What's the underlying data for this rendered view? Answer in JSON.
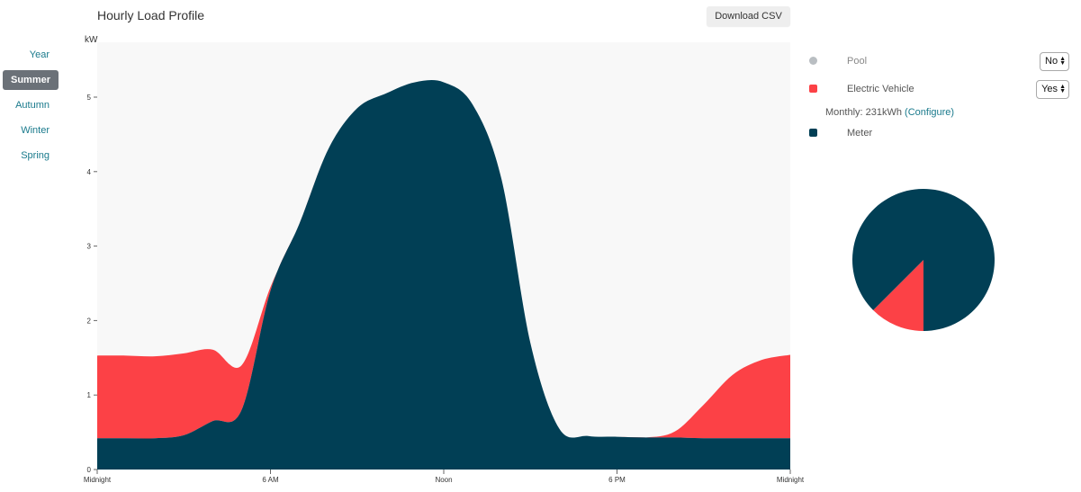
{
  "header": {
    "title": "Hourly Load Profile",
    "download_label": "Download CSV"
  },
  "seasons": [
    {
      "label": "Year",
      "active": false
    },
    {
      "label": "Summer",
      "active": true
    },
    {
      "label": "Autumn",
      "active": false
    },
    {
      "label": "Winter",
      "active": false
    },
    {
      "label": "Spring",
      "active": false
    }
  ],
  "legend": {
    "pool": {
      "label": "Pool",
      "value": "No",
      "color": "#b9bec2"
    },
    "ev": {
      "label": "Electric Vehicle",
      "value": "Yes",
      "color": "#fc4146"
    },
    "monthly_text": "Monthly: 231kWh",
    "configure_label": "(Configure)",
    "meter": {
      "label": "Meter",
      "color": "#013f55"
    }
  },
  "chart_data": [
    {
      "type": "area",
      "stacked": true,
      "title": "Hourly Load Profile",
      "ylabel": "kW",
      "xlabel": "",
      "ylim": [
        0,
        5.6
      ],
      "yticks": [
        0,
        1,
        2,
        3,
        4,
        5
      ],
      "xticks": [
        {
          "hour": 0,
          "label": "Midnight"
        },
        {
          "hour": 6,
          "label": "6 AM"
        },
        {
          "hour": 12,
          "label": "Noon"
        },
        {
          "hour": 18,
          "label": "6 PM"
        },
        {
          "hour": 24,
          "label": "Midnight"
        }
      ],
      "x": [
        0,
        1,
        2,
        3,
        4,
        5,
        6,
        7,
        8,
        9,
        10,
        11,
        12,
        13,
        14,
        15,
        16,
        17,
        18,
        19,
        20,
        21,
        22,
        23,
        24
      ],
      "series": [
        {
          "name": "Meter",
          "color": "#013f55",
          "values": [
            0.42,
            0.42,
            0.42,
            0.46,
            0.65,
            0.8,
            2.4,
            3.3,
            4.3,
            4.85,
            5.05,
            5.2,
            5.2,
            4.9,
            3.9,
            1.7,
            0.55,
            0.45,
            0.44,
            0.43,
            0.43,
            0.42,
            0.42,
            0.42,
            0.42
          ]
        },
        {
          "name": "Electric Vehicle",
          "color": "#fc4146",
          "values": [
            1.11,
            1.11,
            1.1,
            1.1,
            0.96,
            0.6,
            0.05,
            0.0,
            0.0,
            0.0,
            0.0,
            0.0,
            0.0,
            0.0,
            0.0,
            0.0,
            0.0,
            0.0,
            0.0,
            0.0,
            0.08,
            0.45,
            0.85,
            1.05,
            1.12
          ]
        }
      ],
      "background": "#f8f8f8"
    },
    {
      "type": "pie",
      "slices": [
        {
          "name": "Meter",
          "value": 87.5,
          "color": "#013f55"
        },
        {
          "name": "Electric Vehicle",
          "value": 12.5,
          "color": "#fc4146"
        }
      ]
    }
  ]
}
